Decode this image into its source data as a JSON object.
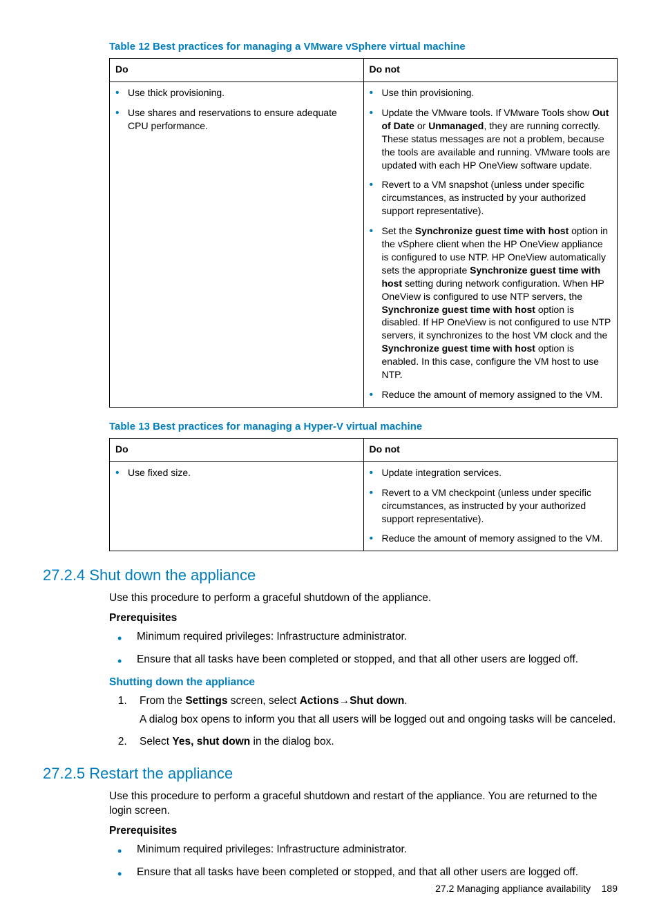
{
  "table12": {
    "caption": "Table 12 Best practices for managing a VMware vSphere virtual machine",
    "headers": {
      "do": "Do",
      "donot": "Do not"
    },
    "do": [
      [
        {
          "t": "Use thick provisioning."
        }
      ],
      [
        {
          "t": "Use shares and reservations to ensure adequate CPU performance."
        }
      ]
    ],
    "donot": [
      [
        {
          "t": "Use thin provisioning."
        }
      ],
      [
        {
          "t": "Update the VMware tools. If VMware Tools show "
        },
        {
          "t": "Out of Date",
          "b": true
        },
        {
          "t": " or "
        },
        {
          "t": "Unmanaged",
          "b": true
        },
        {
          "t": ", they are running correctly. These status messages are not a problem, because the tools are available and running. VMware tools are updated with each HP OneView software update."
        }
      ],
      [
        {
          "t": "Revert to a VM snapshot (unless under specific circumstances, as instructed by your authorized support representative)."
        }
      ],
      [
        {
          "t": "Set the "
        },
        {
          "t": "Synchronize guest time with host",
          "b": true
        },
        {
          "t": " option in the vSphere client when the HP OneView appliance is configured to use NTP. HP OneView automatically sets the appropriate "
        },
        {
          "t": "Synchronize guest time with host",
          "b": true
        },
        {
          "t": " setting during network configuration. When HP OneView is configured to use NTP servers, the "
        },
        {
          "t": "Synchronize guest time with host",
          "b": true
        },
        {
          "t": " option is disabled. If HP OneView is not configured to use NTP servers, it synchronizes to the host VM clock and the "
        },
        {
          "t": "Synchronize guest time with host",
          "b": true
        },
        {
          "t": " option is enabled. In this case, configure the VM host to use NTP."
        }
      ],
      [
        {
          "t": "Reduce the amount of memory assigned to the VM."
        }
      ]
    ]
  },
  "table13": {
    "caption": "Table 13 Best practices for managing a Hyper-V virtual machine",
    "headers": {
      "do": "Do",
      "donot": "Do not"
    },
    "do": [
      [
        {
          "t": "Use fixed size."
        }
      ]
    ],
    "donot": [
      [
        {
          "t": "Update integration services."
        }
      ],
      [
        {
          "t": "Revert to a VM checkpoint (unless under specific circumstances, as instructed by your authorized support representative)."
        }
      ],
      [
        {
          "t": "Reduce the amount of memory assigned to the VM."
        }
      ]
    ]
  },
  "section_27_2_4": {
    "title": "27.2.4 Shut down the appliance",
    "intro": "Use this procedure to perform a graceful shutdown of the appliance.",
    "prereq_label": "Prerequisites",
    "prereqs": [
      "Minimum required privileges: Infrastructure administrator.",
      "Ensure that all tasks have been completed or stopped, and that all other users are logged off."
    ],
    "sub_blue": "Shutting down the appliance",
    "steps": [
      {
        "parts": [
          {
            "t": "From the "
          },
          {
            "t": "Settings",
            "b": true
          },
          {
            "t": " screen, select "
          },
          {
            "t": "Actions",
            "b": true
          },
          {
            "t": "→"
          },
          {
            "t": "Shut down",
            "b": true
          },
          {
            "t": "."
          }
        ],
        "body": "A dialog box opens to inform you that all users will be logged out and ongoing tasks will be canceled."
      },
      {
        "parts": [
          {
            "t": "Select "
          },
          {
            "t": "Yes, shut down",
            "b": true
          },
          {
            "t": " in the dialog box."
          }
        ]
      }
    ]
  },
  "section_27_2_5": {
    "title": "27.2.5 Restart the appliance",
    "intro": "Use this procedure to perform a graceful shutdown and restart of the appliance. You are returned to the login screen.",
    "prereq_label": "Prerequisites",
    "prereqs": [
      "Minimum required privileges: Infrastructure administrator.",
      "Ensure that all tasks have been completed or stopped, and that all other users are logged off."
    ]
  },
  "footer": {
    "section": "27.2 Managing appliance availability",
    "page": "189"
  }
}
